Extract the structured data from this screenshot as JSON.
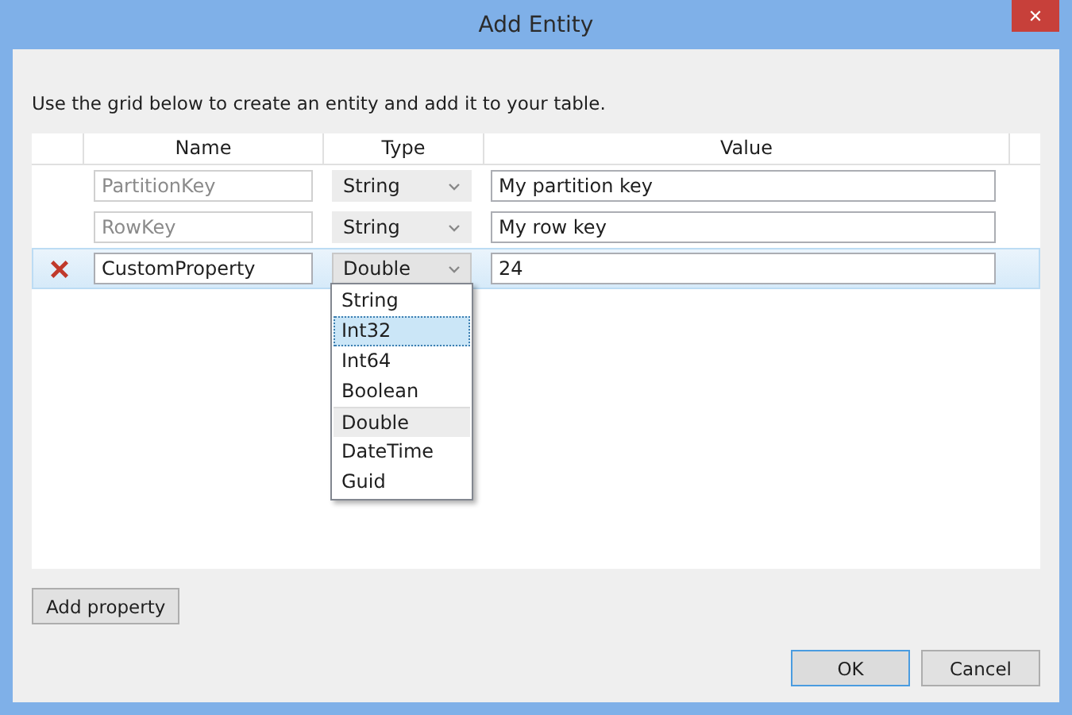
{
  "window": {
    "title": "Add Entity",
    "close": "✕"
  },
  "instructions": "Use the grid below to create an entity and add it to your table.",
  "grid": {
    "columns": [
      "Name",
      "Type",
      "Value"
    ],
    "rows": [
      {
        "name": "PartitionKey",
        "type": "String",
        "value": "My partition key",
        "disabled": true,
        "deletable": false,
        "selected": false
      },
      {
        "name": "RowKey",
        "type": "String",
        "value": "My row key",
        "disabled": true,
        "deletable": false,
        "selected": false
      },
      {
        "name": "CustomProperty",
        "type": "Double",
        "value": "24",
        "disabled": false,
        "deletable": true,
        "selected": true
      }
    ]
  },
  "type_dropdown": {
    "options": [
      {
        "label": "String",
        "selected": false,
        "current": false
      },
      {
        "label": "Int32",
        "selected": true,
        "current": false
      },
      {
        "label": "Int64",
        "selected": false,
        "current": false
      },
      {
        "label": "Boolean",
        "selected": false,
        "current": false
      },
      {
        "label": "Double",
        "selected": false,
        "current": true
      },
      {
        "label": "DateTime",
        "selected": false,
        "current": false
      },
      {
        "label": "Guid",
        "selected": false,
        "current": false
      }
    ]
  },
  "add_button": "Add property",
  "buttons": [
    {
      "label": "OK",
      "default": true
    },
    {
      "label": "Cancel",
      "default": false
    }
  ]
}
